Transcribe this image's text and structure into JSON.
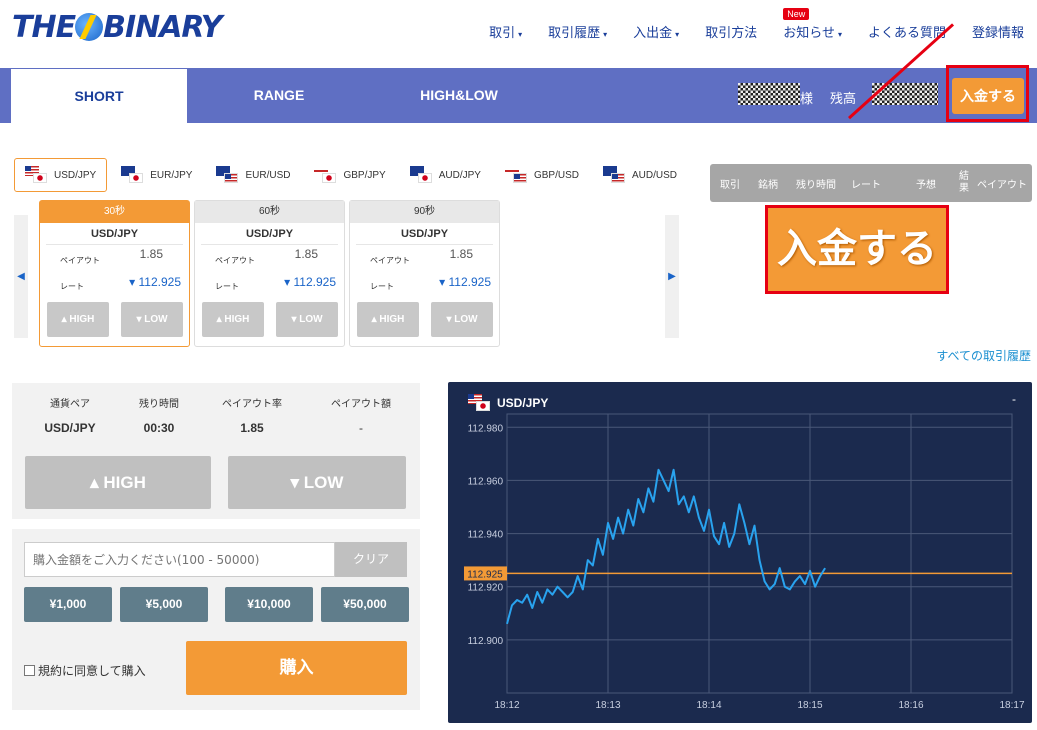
{
  "header": {
    "logo": "THEBINARY",
    "nav": [
      {
        "label": "取引",
        "caret": "▾"
      },
      {
        "label": "取引履歴",
        "caret": "▾"
      },
      {
        "label": "入出金",
        "caret": "▾"
      },
      {
        "label": "取引方法",
        "caret": ""
      },
      {
        "label": "お知らせ",
        "caret": "▾",
        "badge": "New"
      },
      {
        "label": "よくある質問",
        "caret": ""
      },
      {
        "label": "登録情報",
        "caret": ""
      }
    ]
  },
  "tabs": [
    "SHORT",
    "RANGE",
    "HIGH&LOW"
  ],
  "account": {
    "honorific": "様",
    "balance_label": "残高",
    "deposit": "入金する"
  },
  "callout": "入金する",
  "pairs": [
    {
      "label": "USD/JPY",
      "f1": "us",
      "f2": "jp"
    },
    {
      "label": "EUR/JPY",
      "f1": "eu",
      "f2": "jp"
    },
    {
      "label": "EUR/USD",
      "f1": "eu",
      "f2": "us"
    },
    {
      "label": "GBP/JPY",
      "f1": "gb",
      "f2": "jp"
    },
    {
      "label": "AUD/JPY",
      "f1": "au",
      "f2": "jp"
    },
    {
      "label": "GBP/USD",
      "f1": "gb",
      "f2": "us"
    },
    {
      "label": "AUD/USD",
      "f1": "au",
      "f2": "us"
    }
  ],
  "cards": [
    {
      "period": "30秒",
      "pair": "USD/JPY",
      "payout_label": "ペイアウト",
      "payout": "1.85",
      "rate_label": "レート",
      "rate": "▾ 112.925",
      "high": "▴ HIGH",
      "low": "▾ LOW"
    },
    {
      "period": "60秒",
      "pair": "USD/JPY",
      "payout_label": "ペイアウト",
      "payout": "1.85",
      "rate_label": "レート",
      "rate": "▾ 112.925",
      "high": "▴ HIGH",
      "low": "▾ LOW"
    },
    {
      "period": "90秒",
      "pair": "USD/JPY",
      "payout_label": "ペイアウト",
      "payout": "1.85",
      "rate_label": "レート",
      "rate": "▾ 112.925",
      "high": "▴ HIGH",
      "low": "▾ LOW"
    }
  ],
  "trade_table": {
    "headers": [
      "取引",
      "銘柄",
      "残り時間",
      "レート",
      "予想",
      "結果",
      "ペイアウト"
    ]
  },
  "all_history": "すべての取引履歴",
  "info": {
    "labels": [
      "通貨ペア",
      "残り時間",
      "ペイアウト率",
      "ペイアウト額"
    ],
    "values": [
      "USD/JPY",
      "00:30",
      "1.85",
      "-"
    ],
    "high": "▴ HIGH",
    "low": "▾ LOW"
  },
  "purchase": {
    "placeholder": "購入金額をご入力ください(100 - 50000)",
    "clear": "クリア",
    "amounts": [
      "¥1,000",
      "¥5,000",
      "¥10,000",
      "¥50,000"
    ],
    "agree": "規約に同意して購入",
    "buy": "購入"
  },
  "chart_data": {
    "type": "line",
    "title": "USD/JPY",
    "corner": "-",
    "x_ticks": [
      "18:12",
      "18:13",
      "18:14",
      "18:15",
      "18:16",
      "18:17"
    ],
    "y_ticks": [
      "112.980",
      "112.960",
      "112.940",
      "112.920",
      "112.900"
    ],
    "ylim": [
      112.88,
      112.985
    ],
    "xlim_minutes": [
      0,
      5
    ],
    "current_rate": "112.925",
    "current_rate_value": 112.925,
    "series": [
      {
        "x": [
          0.0,
          0.05,
          0.1,
          0.15,
          0.2,
          0.25,
          0.3,
          0.35,
          0.4,
          0.45,
          0.5,
          0.55,
          0.6,
          0.65,
          0.7,
          0.75,
          0.8,
          0.85,
          0.9,
          0.95,
          1.0,
          1.05,
          1.1,
          1.15,
          1.2,
          1.25,
          1.3,
          1.35,
          1.4,
          1.45,
          1.5,
          1.55,
          1.6,
          1.65,
          1.7,
          1.75,
          1.8,
          1.85,
          1.9,
          1.95,
          2.0,
          2.05,
          2.1,
          2.15,
          2.2,
          2.25,
          2.3,
          2.35,
          2.4,
          2.45,
          2.5,
          2.55,
          2.6,
          2.65,
          2.7,
          2.75,
          2.8,
          2.85,
          2.9,
          2.95,
          3.0,
          3.05,
          3.1,
          3.15
        ],
        "values": [
          112.906,
          112.913,
          112.915,
          112.914,
          112.917,
          112.912,
          112.918,
          112.914,
          112.919,
          112.917,
          112.92,
          112.918,
          112.916,
          112.918,
          112.924,
          112.919,
          112.93,
          112.928,
          112.938,
          112.932,
          112.944,
          112.938,
          112.946,
          112.94,
          112.949,
          112.943,
          112.953,
          112.948,
          112.957,
          112.952,
          112.964,
          112.96,
          112.956,
          112.964,
          112.951,
          112.954,
          112.948,
          112.954,
          112.946,
          112.941,
          112.949,
          112.939,
          112.936,
          112.944,
          112.935,
          112.94,
          112.951,
          112.944,
          112.936,
          112.943,
          112.93,
          112.922,
          112.919,
          112.921,
          112.927,
          112.92,
          112.919,
          112.922,
          112.924,
          112.921,
          112.926,
          112.92,
          112.924,
          112.927
        ]
      }
    ]
  }
}
